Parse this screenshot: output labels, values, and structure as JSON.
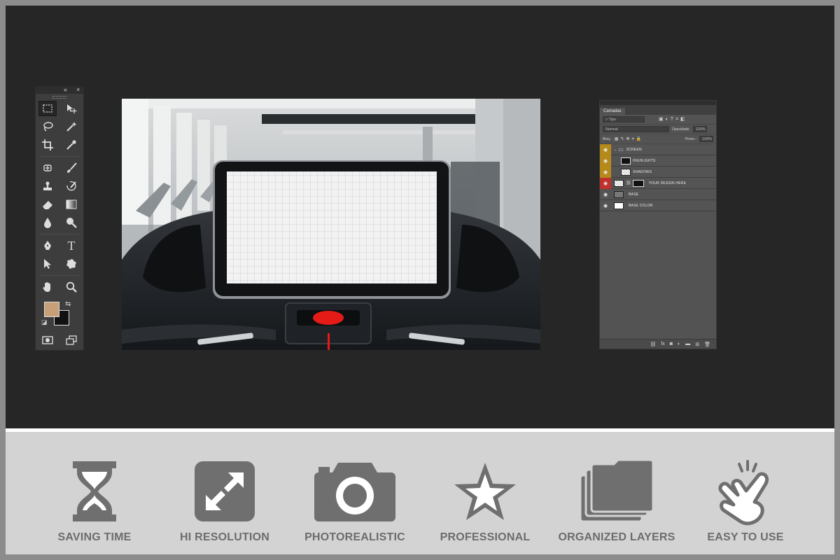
{
  "toolbar": {
    "collapse_glyph": "«",
    "close_glyph": "×",
    "tools": [
      [
        "rectangular-marquee-icon",
        "move-icon"
      ],
      [
        "lasso-icon",
        "magic-wand-icon"
      ],
      [
        "crop-icon",
        "eyedropper-icon"
      ],
      [
        "spot-healing-icon",
        "brush-icon"
      ],
      [
        "clone-stamp-icon",
        "history-brush-icon"
      ],
      [
        "eraser-icon",
        "gradient-icon"
      ],
      [
        "blur-icon",
        "dodge-icon"
      ],
      [
        "pen-icon",
        "type-icon"
      ],
      [
        "path-selection-icon",
        "custom-shape-icon"
      ],
      [
        "hand-icon",
        "zoom-icon"
      ]
    ],
    "type_glyph": "T",
    "foreground_color": "#c8a077",
    "background_color": "#111111"
  },
  "layers_panel": {
    "tab_label": "Camadas",
    "filter_label": "Tipo",
    "blend_mode": "Normal",
    "opacity_label": "Opacidade:",
    "opacity_value": "100%",
    "lock_label": "Bloq.:",
    "fill_label": "Preen.:",
    "fill_value": "100%",
    "layers": [
      {
        "name": "SCREEN",
        "eye_color": "#b58a1b",
        "kind": "group"
      },
      {
        "name": "HIGHLIGHTS",
        "eye_color": "#b58a1b",
        "kind": "dark"
      },
      {
        "name": "SHADOWS",
        "eye_color": "#b58a1b",
        "kind": "check"
      },
      {
        "name": "YOUR DESIGN HERE",
        "eye_color": "#c0302e",
        "kind": "smart"
      },
      {
        "name": "BASE",
        "eye_color": "#5a5a5a",
        "kind": "photo"
      },
      {
        "name": "BASE COLOR",
        "eye_color": "#5a5a5a",
        "kind": "white"
      }
    ],
    "footer_icons": [
      "link-icon",
      "fx-icon",
      "mask-icon",
      "adjustment-icon",
      "folder-icon",
      "new-layer-icon",
      "trash-icon"
    ]
  },
  "features": [
    {
      "label": "SAVING TIME",
      "icon": "hourglass-icon"
    },
    {
      "label": "HI RESOLUTION",
      "icon": "expand-icon"
    },
    {
      "label": "PHOTOREALISTIC",
      "icon": "camera-icon"
    },
    {
      "label": "PROFESSIONAL",
      "icon": "star-icon"
    },
    {
      "label": "ORGANIZED LAYERS",
      "icon": "layers-icon"
    },
    {
      "label": "EASY TO USE",
      "icon": "hand-pointer-icon"
    }
  ],
  "colors": {
    "workspace": "#262626",
    "feature_bar": "#d3d3d3",
    "feature_icon": "#6f6f6f",
    "feature_text": "#6c6c6c",
    "accent_red": "#e41b17"
  }
}
